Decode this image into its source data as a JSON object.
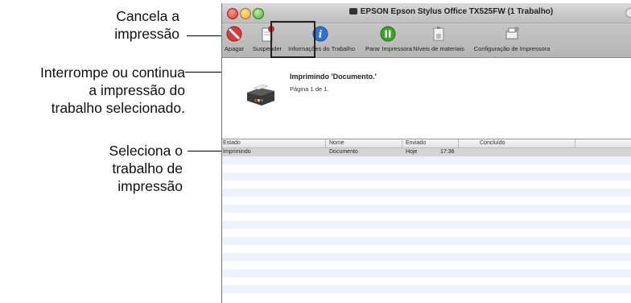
{
  "annotations": {
    "cancel": [
      "Cancela a",
      "impressão"
    ],
    "suspend": [
      "Interrompe ou continua",
      "a impressão do",
      "trabalho selecionado."
    ],
    "select": [
      "Seleciona o",
      "trabalho de",
      "impressão"
    ]
  },
  "window": {
    "title": "EPSON Epson Stylus Office TX525FW (1 Trabalho)",
    "toolbar": {
      "apagar": "Apagar",
      "suspender": "Suspender",
      "info": "Informações do Trabalho",
      "parar": "Parar Impressora",
      "niveis": "Níveis de materiais",
      "config": "Configuração de Impressora",
      "more": "›"
    }
  },
  "document": {
    "title": "Imprimindo 'Documento.'",
    "page": "Página 1 de 1."
  },
  "table": {
    "headers": {
      "estado": "Estado",
      "nome": "Nome",
      "enviado": "Enviado",
      "concluido": "Concluído"
    },
    "rows": [
      {
        "estado": "Imprimindo",
        "nome": "Documento",
        "enviado_dia": "Hoje",
        "enviado_hora": "17:36",
        "concluido": ""
      }
    ]
  },
  "colors": {
    "selected_row": "#d4d4d4",
    "stripe": "#edf3fe",
    "stop_icon": "#3aa52a",
    "info_icon": "#2f72d6",
    "apagar_icon": "#d93b3b"
  }
}
